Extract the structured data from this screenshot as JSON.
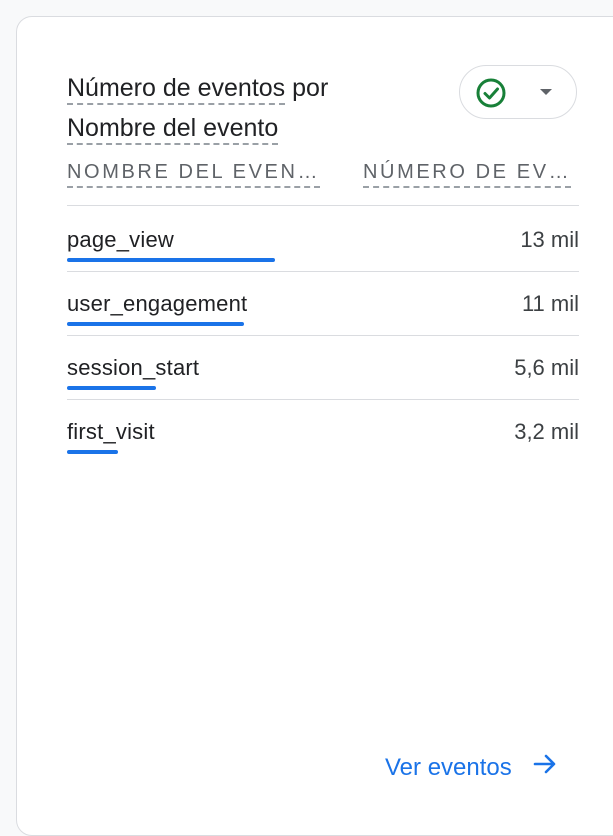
{
  "card": {
    "title_part1": "Número de eventos",
    "title_part2": " por",
    "title_part3": "Nombre del evento",
    "status_icon": "check-circle-icon",
    "dropdown_icon": "arrow-drop-down-icon"
  },
  "table": {
    "columns": [
      "NOMBRE DEL EVEN…",
      "NÚMERO DE EV…"
    ],
    "rows": [
      {
        "name": "page_view",
        "value": "13 mil",
        "share": 1.0
      },
      {
        "name": "user_engagement",
        "value": "11 mil",
        "share": 0.85
      },
      {
        "name": "session_start",
        "value": "5,6 mil",
        "share": 0.43
      },
      {
        "name": "first_visit",
        "value": "3,2 mil",
        "share": 0.245
      }
    ]
  },
  "footer": {
    "link_label": "Ver eventos",
    "link_icon": "arrow-forward-icon"
  },
  "colors": {
    "accent": "#1a73e8",
    "success": "#188038",
    "text": "#202124",
    "muted": "#5f6368"
  }
}
